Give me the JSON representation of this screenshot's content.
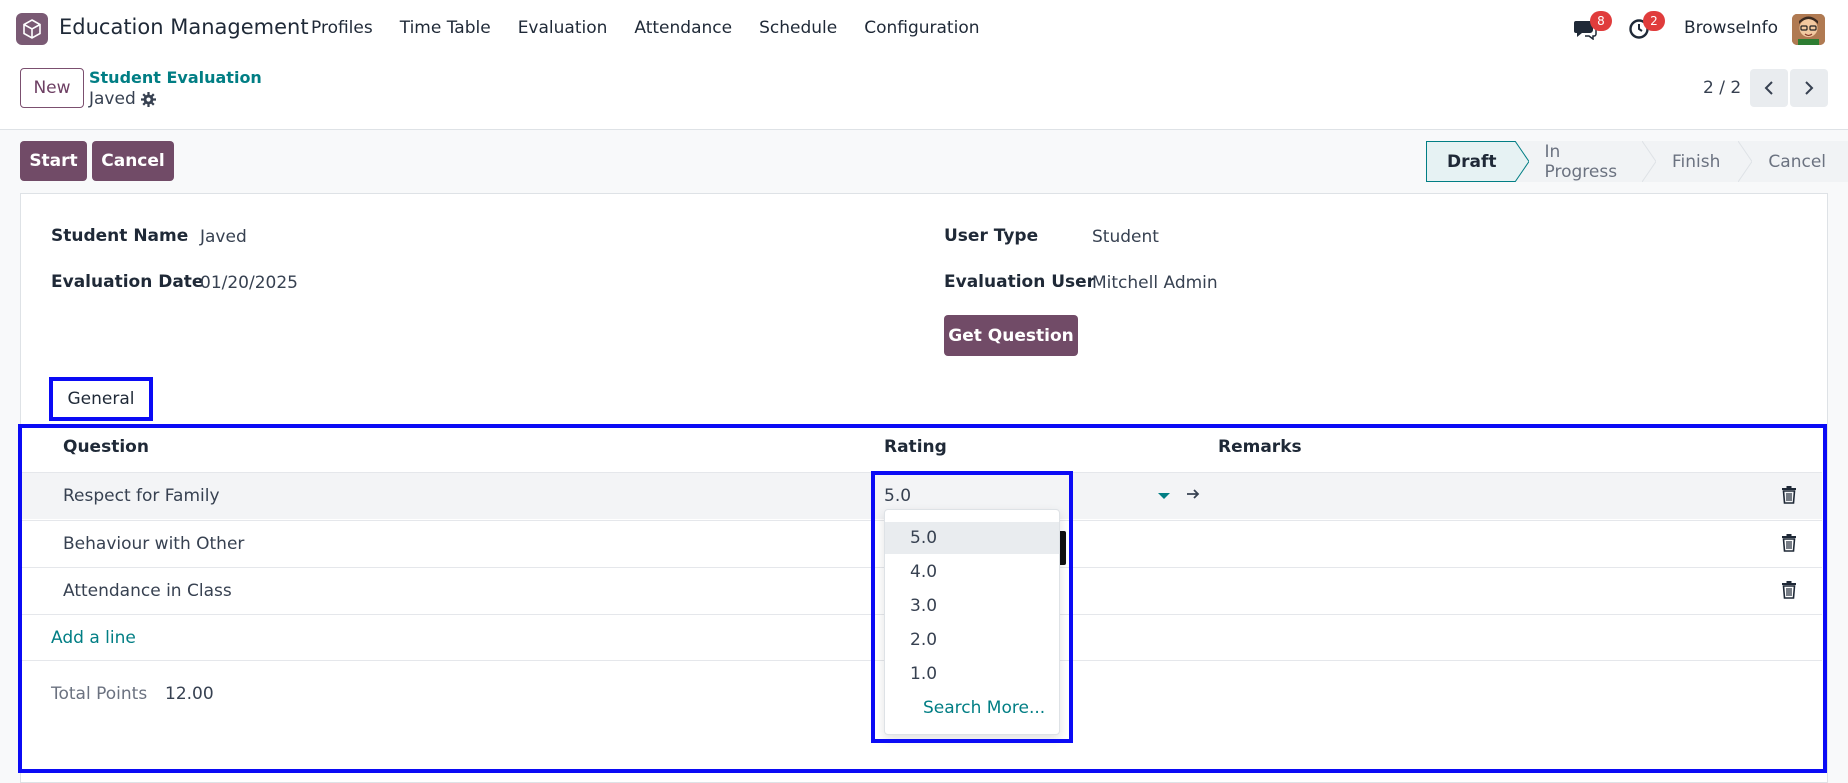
{
  "app": {
    "name": "Education Management"
  },
  "menu": [
    "Profiles",
    "Time Table",
    "Evaluation",
    "Attendance",
    "Schedule",
    "Configuration"
  ],
  "systray": {
    "messages_count": "8",
    "activities_count": "2",
    "user_name": "BrowseInfo"
  },
  "control": {
    "new_label": "New",
    "breadcrumb": "Student Evaluation",
    "record_name": "Javed",
    "pager": "2 / 2"
  },
  "actions": {
    "start_label": "Start",
    "cancel_label": "Cancel"
  },
  "statusbar": {
    "stages": [
      "Draft",
      "In Progress",
      "Finish",
      "Cancel"
    ],
    "current": "Draft"
  },
  "form": {
    "student_name_label": "Student Name",
    "student_name": "Javed",
    "evaluation_date_label": "Evaluation Date",
    "evaluation_date": "01/20/2025",
    "user_type_label": "User Type",
    "user_type": "Student",
    "evaluation_user_label": "Evaluation User",
    "evaluation_user": "Mitchell Admin",
    "get_question_label": "Get Question"
  },
  "tabs": {
    "general": "General"
  },
  "table": {
    "headers": {
      "question": "Question",
      "rating": "Rating",
      "remarks": "Remarks"
    },
    "rows": [
      {
        "question": "Respect for Family",
        "rating": "5.0"
      },
      {
        "question": "Behaviour with Other"
      },
      {
        "question": "Attendance in Class"
      }
    ],
    "add_line": "Add a line"
  },
  "rating_dropdown": {
    "options": [
      "5.0",
      "4.0",
      "3.0",
      "2.0",
      "1.0"
    ],
    "search_more": "Search More..."
  },
  "totals": {
    "label": "Total Points",
    "value": "12.00"
  },
  "colors": {
    "primary": "#714b67",
    "link": "#017e84",
    "highlight": "#0b0bf5",
    "badge": "#e03c3c"
  }
}
